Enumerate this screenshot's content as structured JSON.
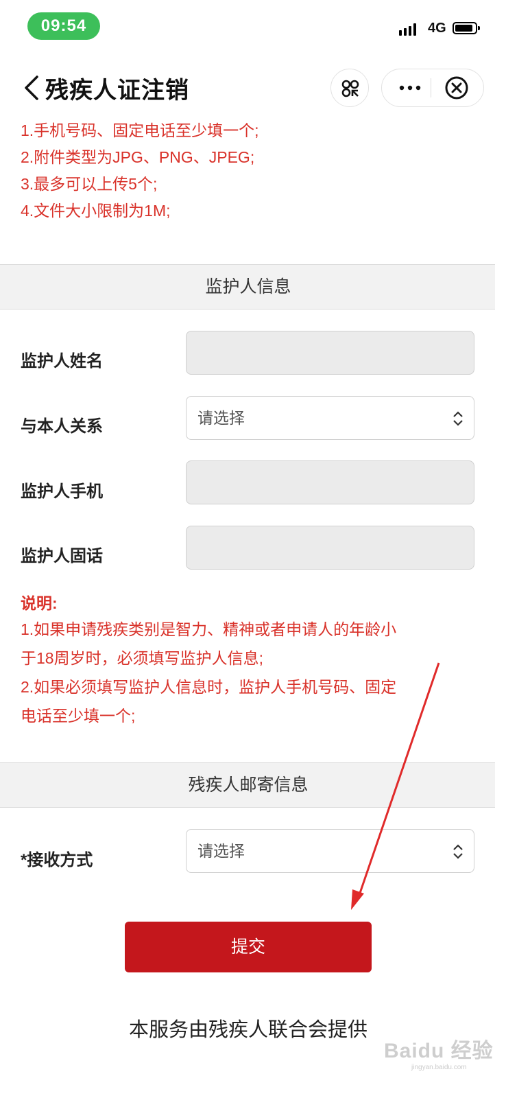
{
  "status_bar": {
    "time": "09:54",
    "network": "4G"
  },
  "header": {
    "title": "残疾人证注销"
  },
  "notes_top": [
    "1.手机号码、固定电话至少填一个;",
    "2.附件类型为JPG、PNG、JPEG;",
    "3.最多可以上传5个;",
    "4.文件大小限制为1M;"
  ],
  "guardian_section": {
    "title": "监护人信息",
    "name_label": "监护人姓名",
    "relation_label": "与本人关系",
    "relation_placeholder": "请选择",
    "mobile_label": "监护人手机",
    "landline_label": "监护人固话"
  },
  "explanation": {
    "heading": "说明:",
    "lines": [
      "1.如果申请残疾类别是智力、精神或者申请人的年龄小",
      "于18周岁时，必须填写监护人信息;",
      "2.如果必须填写监护人信息时，监护人手机号码、固定",
      "电话至少填一个;"
    ]
  },
  "mail_section": {
    "title": "残疾人邮寄信息",
    "receive_label": "*接收方式",
    "receive_placeholder": "请选择"
  },
  "submit_label": "提交",
  "footer": "本服务由残疾人联合会提供",
  "watermark": {
    "text": "Baidu 经验",
    "sub": "jingyan.baidu.com"
  },
  "colors": {
    "accent_red": "#c4171c",
    "note_red": "#d9322a",
    "time_green": "#3dbf5a"
  }
}
